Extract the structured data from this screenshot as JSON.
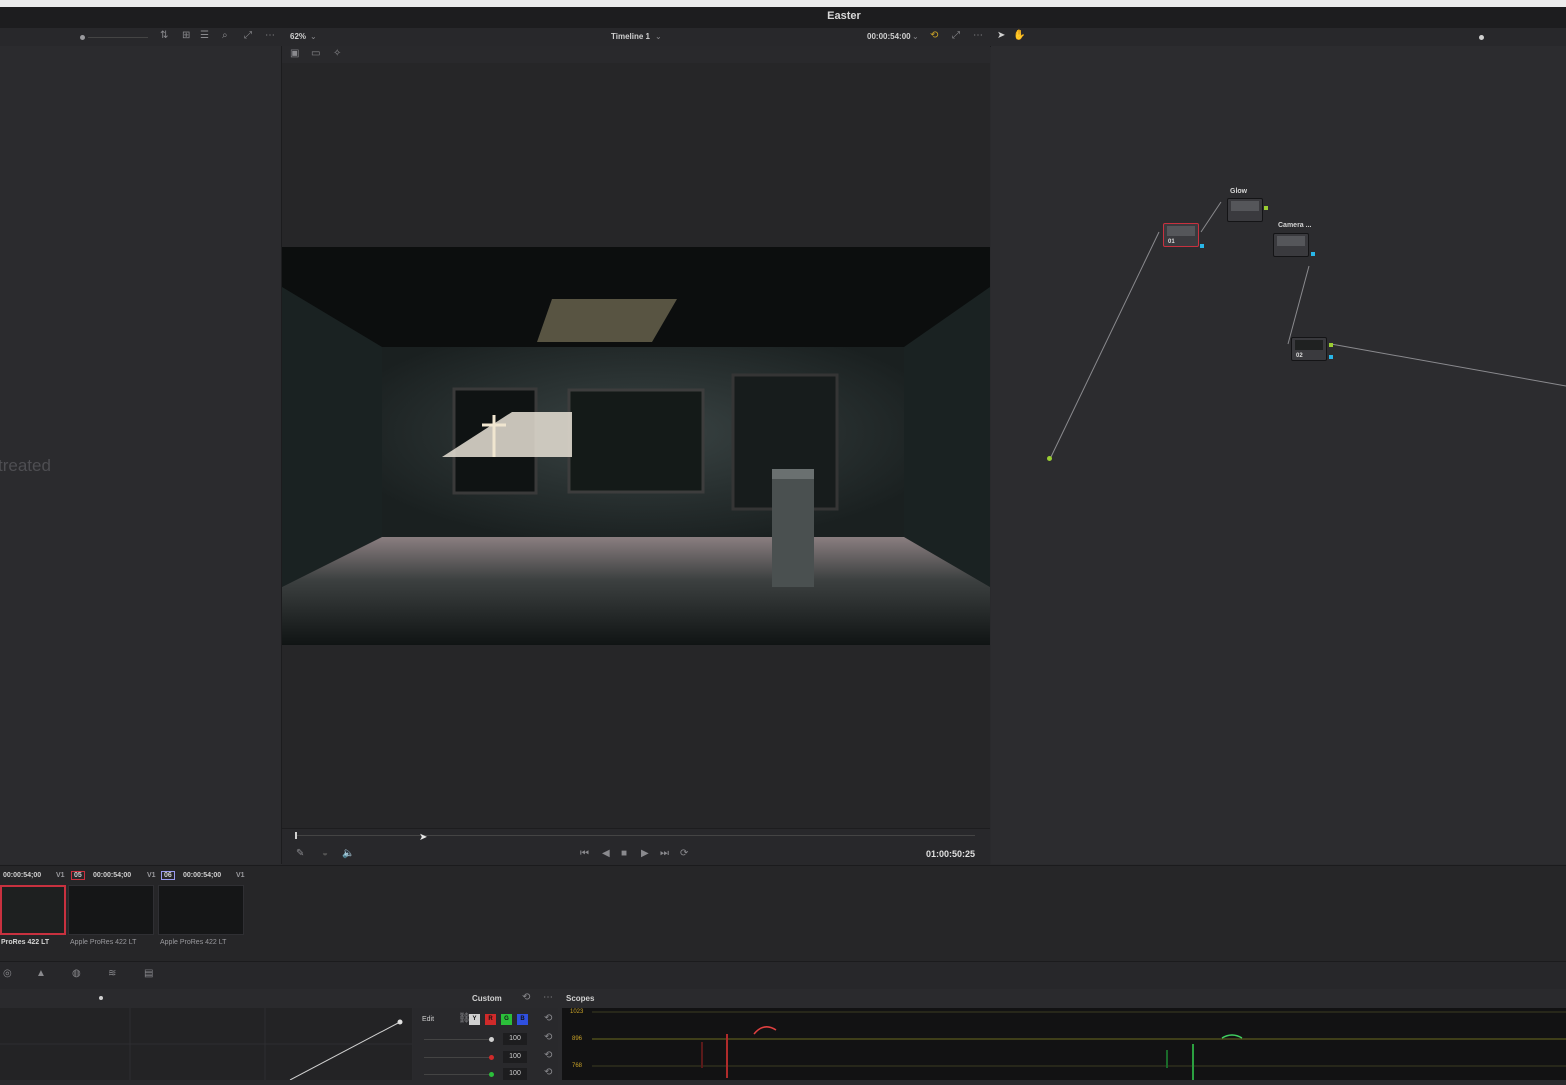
{
  "app": {
    "title": "Easter"
  },
  "toolbar": {
    "zoom": "62%",
    "timeline_name": "Timeline 1",
    "timecode": "00:00:54:00"
  },
  "left_panel": {
    "watermark_text": "treated"
  },
  "viewer": {
    "current_timecode": "01:00:50:25"
  },
  "nodes": [
    {
      "label": "",
      "num": "01"
    },
    {
      "label": "Glow",
      "num": ""
    },
    {
      "label": "Camera ...",
      "num": ""
    },
    {
      "label": "",
      "num": "02"
    }
  ],
  "clips": [
    {
      "timecode": "00:00:54;00",
      "track": "V1",
      "index": "",
      "codec": "ProRes 422 LT"
    },
    {
      "timecode": "00:00:54;00",
      "track": "V1",
      "index": "05",
      "codec": "Apple ProRes 422 LT"
    },
    {
      "timecode": "00:00:54;00",
      "track": "V1",
      "index": "06",
      "codec": "Apple ProRes 422 LT"
    }
  ],
  "curves": {
    "mode": "Custom",
    "edit_label": "Edit",
    "channels": [
      "Y",
      "R",
      "G",
      "B"
    ],
    "values": [
      "100",
      "100",
      "100"
    ]
  },
  "scopes": {
    "title": "Scopes",
    "ticks": [
      "1023",
      "896",
      "768"
    ]
  },
  "colors": {
    "accent_red": "#c8313f",
    "node_green": "#9acd32",
    "node_blue": "#29b6e8"
  }
}
